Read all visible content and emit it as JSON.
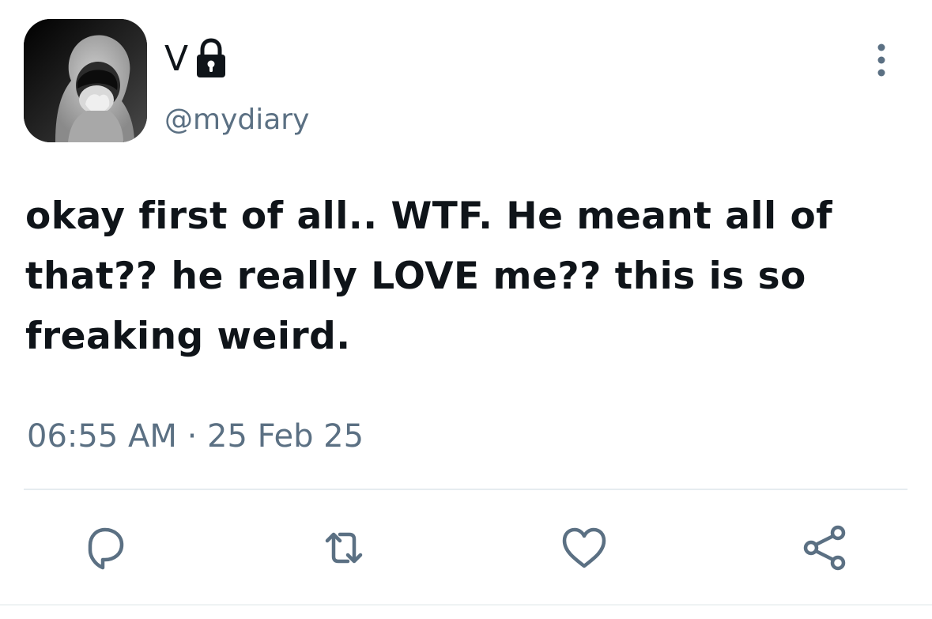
{
  "user": {
    "display_name": "V",
    "handle": "@mydiary",
    "protected_icon": "lock-icon"
  },
  "tweet": {
    "text": "okay first of all.. WTF. He meant all of that?? he really LOVE me?? this is so freaking weird.",
    "time": "06:55 AM",
    "separator": "·",
    "date": "25 Feb 25"
  },
  "actions": [
    {
      "name": "reply",
      "icon": "comment-icon"
    },
    {
      "name": "retweet",
      "icon": "retweet-icon"
    },
    {
      "name": "like",
      "icon": "heart-icon"
    },
    {
      "name": "share",
      "icon": "share-icon"
    }
  ],
  "colors": {
    "text": "#0f1419",
    "secondary": "#5b7083",
    "divider": "#e6ecf0",
    "icon": "#5b7083"
  }
}
